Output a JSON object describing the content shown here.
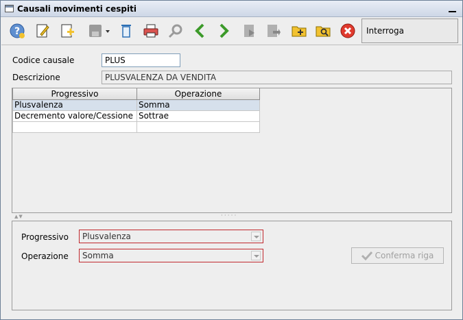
{
  "window": {
    "title": "Causali movimenti cespiti"
  },
  "toolbar": {
    "buttons": [
      {
        "name": "help-icon"
      },
      {
        "name": "edit-icon"
      },
      {
        "name": "new-record-icon"
      },
      {
        "name": "save-icon"
      },
      {
        "name": "delete-icon"
      },
      {
        "name": "print-icon"
      },
      {
        "name": "search-icon"
      },
      {
        "name": "previous-icon"
      },
      {
        "name": "next-icon"
      },
      {
        "name": "run-icon"
      },
      {
        "name": "export-icon"
      },
      {
        "name": "new-folder-icon"
      },
      {
        "name": "folder-search-icon"
      },
      {
        "name": "close-icon"
      }
    ],
    "mode_label": "Interroga"
  },
  "form": {
    "codice_label": "Codice causale",
    "codice_value": "PLUS",
    "descrizione_label": "Descrizione",
    "descrizione_value": "PLUSVALENZA DA VENDITA"
  },
  "grid": {
    "columns": [
      "Progressivo",
      "Operazione"
    ],
    "rows": [
      [
        "Plusvalenza",
        "Somma"
      ],
      [
        "Decremento valore/Cessione",
        "Sottrae"
      ],
      [
        "",
        ""
      ]
    ],
    "selected_row": 0
  },
  "detail": {
    "progressivo_label": "Progressivo",
    "progressivo_value": "Plusvalenza",
    "operazione_label": "Operazione",
    "operazione_value": "Somma",
    "confirm_label": "Conferma riga"
  },
  "colors": {
    "accent_green": "#3c9a2a",
    "close_red": "#e03a2e",
    "folder_yellow": "#f2c230",
    "invalid_border": "#c0282d"
  }
}
